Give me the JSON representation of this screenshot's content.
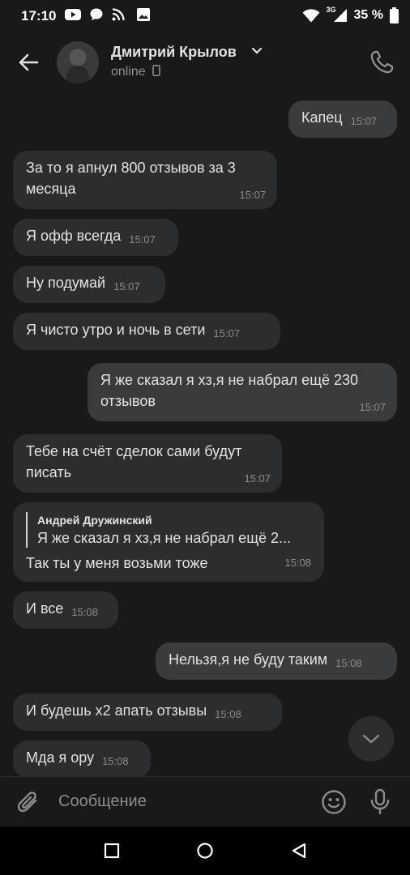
{
  "statusbar": {
    "time": "17:10",
    "network_label": "3G",
    "battery": "35 %"
  },
  "header": {
    "name": "Дмитрий Крылов",
    "status": "online"
  },
  "messages": [
    {
      "text": "Капец",
      "time": "15:07"
    },
    {
      "text": "За то я апнул 800 отзывов за 3 месяца",
      "time": "15:07"
    },
    {
      "text": "Я офф всегда",
      "time": "15:07"
    },
    {
      "text": "Ну подумай",
      "time": "15:07"
    },
    {
      "text": "Я чисто утро и ночь в сети",
      "time": "15:07"
    },
    {
      "text": "Я же сказал я хз,я не набрал ещё 230 отзывов",
      "time": "15:07"
    },
    {
      "text": "Тебе на счёт сделок сами будут писать",
      "time": "15:07"
    },
    {
      "reply_author": "Андрей Дружинский",
      "reply_text": "Я же сказал я хз,я не набрал ещё 2...",
      "text": "Так ты у меня возьми тоже",
      "time": "15:08"
    },
    {
      "text": "И все",
      "time": "15:08"
    },
    {
      "text": "Нельзя,я не буду таким",
      "time": "15:08"
    },
    {
      "text": "И будешь х2 апать отзывы",
      "time": "15:08"
    },
    {
      "text": "Мда я ору",
      "time": "15:08"
    }
  ],
  "composer": {
    "placeholder": "Сообщение"
  },
  "icons": {
    "back": "arrow-left-icon",
    "phone": "phone-icon",
    "attach": "paperclip-icon",
    "emoji": "smile-icon",
    "mic": "microphone-icon",
    "scroll": "chevron-down-icon"
  }
}
